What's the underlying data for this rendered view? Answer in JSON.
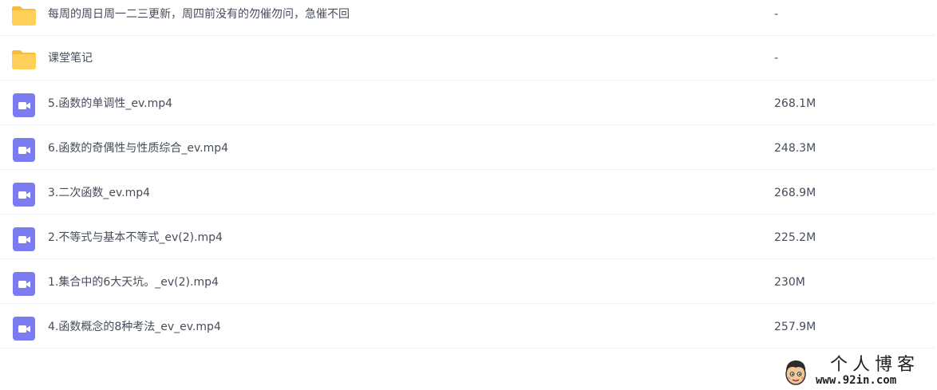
{
  "files": [
    {
      "type": "folder",
      "name": "每周的周日周一二三更新，周四前没有的勿催勿问，急催不回",
      "size": "-"
    },
    {
      "type": "folder",
      "name": "课堂笔记",
      "size": "-"
    },
    {
      "type": "video",
      "name": "5.函数的单调性_ev.mp4",
      "size": "268.1M"
    },
    {
      "type": "video",
      "name": "6.函数的奇偶性与性质综合_ev.mp4",
      "size": "248.3M"
    },
    {
      "type": "video",
      "name": "3.二次函数_ev.mp4",
      "size": "268.9M"
    },
    {
      "type": "video",
      "name": "2.不等式与基本不等式_ev(2).mp4",
      "size": "225.2M"
    },
    {
      "type": "video",
      "name": "1.集合中的6大天坑。_ev(2).mp4",
      "size": "230M"
    },
    {
      "type": "video",
      "name": "4.函数概念的8种考法_ev_ev.mp4",
      "size": "257.9M"
    }
  ],
  "icons": {
    "folder": "folder-icon",
    "video": "video-file-icon"
  },
  "colors": {
    "folder": "#ffd05a",
    "folder_tab": "#f6bd3b",
    "video": "#7b7cf0",
    "text": "#454d5a",
    "divider": "#f0f1f3"
  },
  "watermark": {
    "title": "个人博客",
    "url": "www.92in.com"
  }
}
